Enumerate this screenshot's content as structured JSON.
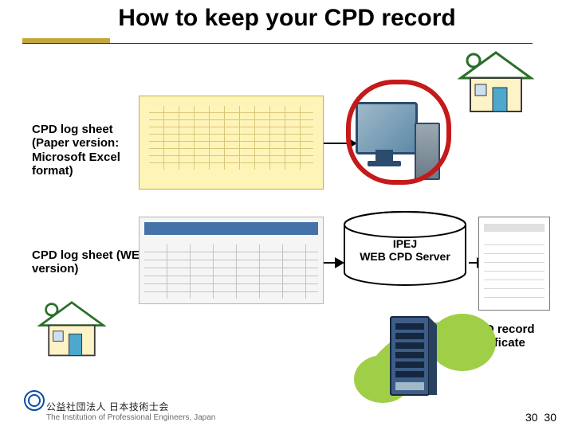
{
  "title": "How to keep your CPD record",
  "labels": {
    "paper": "CPD log sheet (Paper version: Microsoft Excel format)",
    "web": "CPD log sheet (WEB version)",
    "server_line1": "IPEJ",
    "server_line2": "WEB CPD Server",
    "certificate": "CPD record certificate"
  },
  "footer": {
    "org_jp": "公益社団法人 日本技術士会",
    "org_en": "The Institution of Professional Engineers, Japan"
  },
  "page_number_a": "30",
  "page_number_b": "30"
}
